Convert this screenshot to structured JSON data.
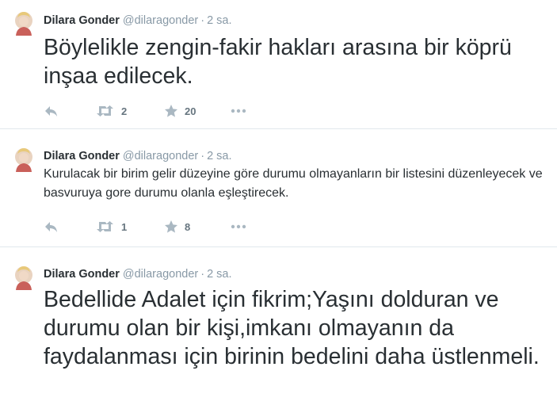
{
  "tweets": [
    {
      "fullname": "Dilara Gonder",
      "username": "@dilaragonder",
      "separator": "·",
      "time": "2 sa.",
      "text": "Böylelikle zengin-fakir hakları arasına bir köprü inşaa edilecek.",
      "retweets": "2",
      "favorites": "20"
    },
    {
      "fullname": "Dilara Gonder",
      "username": "@dilaragonder",
      "separator": "·",
      "time": "2 sa.",
      "text": "Kurulacak bir birim gelir düzeyine göre durumu olmayanların bir listesini düzenleyecek ve basvuruya gore durumu olanla eşleştirecek.",
      "retweets": "1",
      "favorites": "8"
    },
    {
      "fullname": "Dilara Gonder",
      "username": "@dilaragonder",
      "separator": "·",
      "time": "2 sa.",
      "text": "Bedellide Adalet için fikrim;Yaşını dolduran ve durumu olan bir kişi,imkanı olmayanın da faydalanması için birinin bedelini daha üstlenmeli."
    }
  ],
  "icons": {
    "reply": "reply-icon",
    "retweet": "retweet-icon",
    "favorite": "star-icon",
    "more": "more-icon"
  },
  "colors": {
    "text": "#292f33",
    "muted": "#8899a6",
    "icon": "#aab8c2",
    "count": "#66757f",
    "divider": "#e1e8ed"
  }
}
